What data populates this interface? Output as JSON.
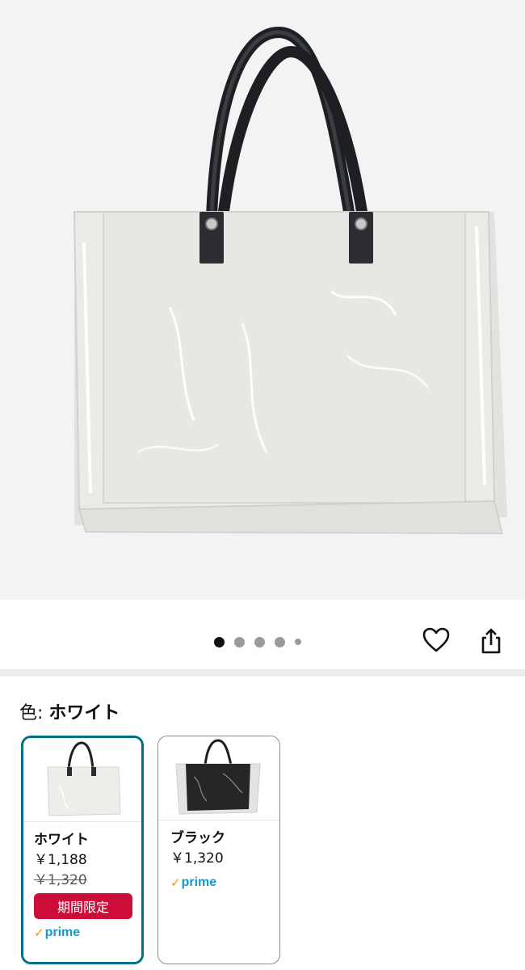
{
  "gallery": {
    "image_count": 5,
    "active_index": 0,
    "favorite_icon": "heart-outline-icon",
    "share_icon": "share-icon"
  },
  "variation": {
    "label": "色:",
    "selected_value": "ホワイト"
  },
  "swatches": [
    {
      "name": "ホワイト",
      "price": "￥1,188",
      "list_price": "￥1,320",
      "deal_badge": "期間限定",
      "prime": "prime",
      "selected": true
    },
    {
      "name": "ブラック",
      "price": "￥1,320",
      "prime": "prime",
      "selected": false
    }
  ],
  "colors": {
    "selected_border": "#007185",
    "deal_red": "#cc0c39",
    "prime_blue": "#1799c7",
    "prime_orange": "#f79400"
  }
}
